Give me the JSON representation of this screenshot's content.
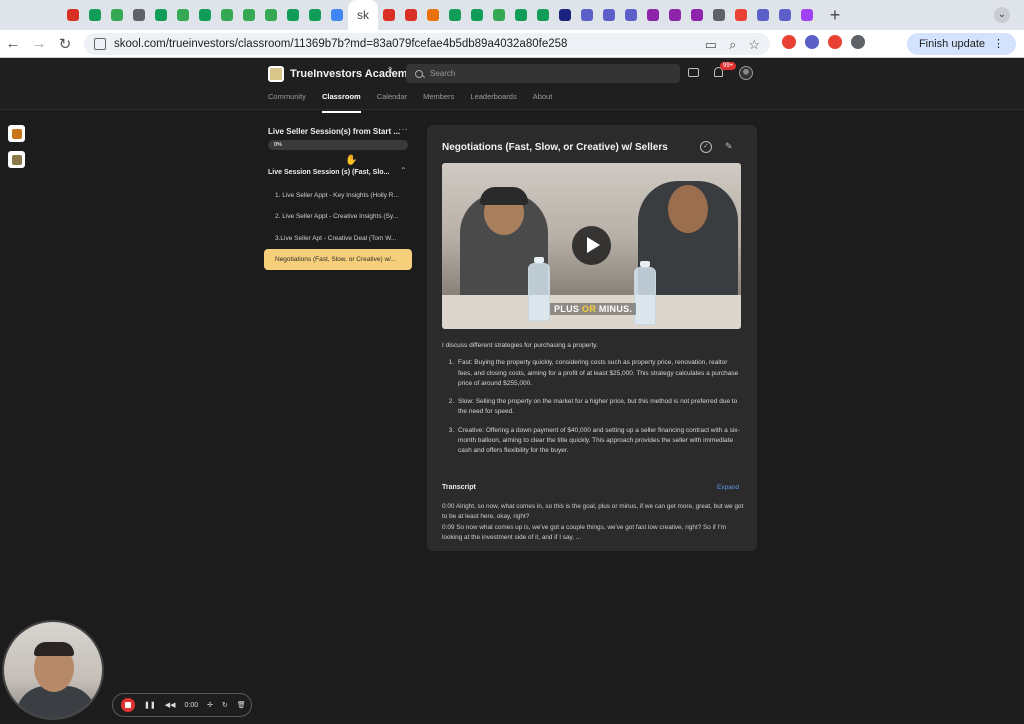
{
  "browser": {
    "url": "skool.com/trueinvestors/classroom/11369b7b?md=83a079fcefae4b5db89a4032a80fe258",
    "active_tab_label": "sk",
    "finish_update_label": "Finish update",
    "tab_favicon_colors": [
      "#d93025",
      "#0f9d58",
      "#34a853",
      "#5f6368",
      "#0f9d58",
      "#34a853",
      "#0f9d58",
      "#34a853",
      "#34a853",
      "#34a853",
      "#0f9d58",
      "#0f9d58",
      "#4285f4",
      "#d93025",
      "#d93025",
      "#e8710a",
      "#0f9d58",
      "#0f9d58",
      "#34a853",
      "#0f9d58",
      "#0f9d58",
      "#1a237e",
      "#5b5fc7",
      "#5b5fc7",
      "#5b5fc7",
      "#8e24aa",
      "#8e24aa",
      "#8e24aa",
      "#5f6368",
      "#e94235",
      "#5b5fc7",
      "#5b5fc7",
      "#a142f4"
    ],
    "extension_colors": [
      "#e94235",
      "#5b5fc7",
      "#e94235",
      "#5f6368"
    ]
  },
  "header": {
    "group_name": "TrueInvestors Academy",
    "search_placeholder": "Search",
    "notification_count": "99+",
    "nav": [
      "Community",
      "Classroom",
      "Calendar",
      "Members",
      "Leaderboards",
      "About"
    ],
    "active_nav": "Classroom"
  },
  "sidebar": {
    "course_title": "Live Seller Session(s) from Start ...",
    "progress_label": "0%",
    "progress_value": 0,
    "module_title": "Live Session Session (s) (Fast, Slo...",
    "lessons": [
      "1. Live Seller Appt - Key Insights (Holly R...",
      "2. Live Seller Appt - Creative Insights (Sy...",
      "3.Live Seller Apt - Creative Deal (Tom W...",
      "Negotiations (Fast, Slow, or Creative) w/..."
    ],
    "selected_index": 3
  },
  "lesson": {
    "title": "Negotiations (Fast, Slow, or Creative) w/ Sellers",
    "video_caption_pre": "PLUS ",
    "video_caption_or": "OR",
    "video_caption_post": " MINUS.",
    "intro": "I discuss different strategies for purchasing a property.",
    "strategies": [
      "Fast: Buying the property quickly, considering costs such as property price, renovation, realtor fees, and closing costs, aiming for a profit of at least $25,000. This strategy calculates a purchase price of around $255,000.",
      "Slow: Selling the property on the market for a higher price, but this method is not preferred due to the need for speed.",
      "Creative: Offering a down payment of $40,000 and setting up a seller financing contract with a six-month balloon, aiming to clear the title quickly. This approach provides the seller with immediate cash and offers flexibility for the buyer."
    ],
    "transcript_label": "Transcript",
    "expand_label": "Expand",
    "transcript_lines": [
      "0:00 Alright, so now, what comes in, so this is the goal, plus or minus, if we can get more, great, but we got to be at least here, okay, right?",
      "0:09 So now what comes up is, we've got a couple things, we've got fast low creative, right? So if I'm looking at the investment side of it, and if I say, ..."
    ]
  },
  "recorder": {
    "time": "0:00"
  }
}
